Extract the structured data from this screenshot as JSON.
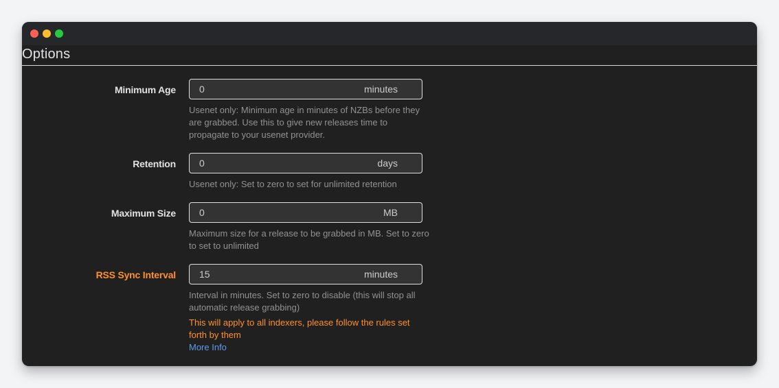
{
  "section": {
    "title": "Options"
  },
  "fields": [
    {
      "label": "Minimum Age",
      "value": "0",
      "unit": "minutes",
      "help": "Usenet only: Minimum age in minutes of NZBs before they are grabbed. Use this to give new releases time to propagate to your usenet provider."
    },
    {
      "label": "Retention",
      "value": "0",
      "unit": "days",
      "help": "Usenet only: Set to zero to set for unlimited retention"
    },
    {
      "label": "Maximum Size",
      "value": "0",
      "unit": "MB",
      "help": "Maximum size for a release to be grabbed in MB. Set to zero to set to unlimited"
    },
    {
      "label": "RSS Sync Interval",
      "value": "15",
      "unit": "minutes",
      "help": "Interval in minutes. Set to zero to disable (this will stop all automatic release grabbing)",
      "warning": "This will apply to all indexers, please follow the rules set forth by them",
      "link": "More Info"
    }
  ],
  "colors": {
    "window_bg": "#202020",
    "titlebar_bg": "#26272b",
    "warning": "#ff902b",
    "link": "#5d9cec",
    "help_text": "#909293"
  }
}
